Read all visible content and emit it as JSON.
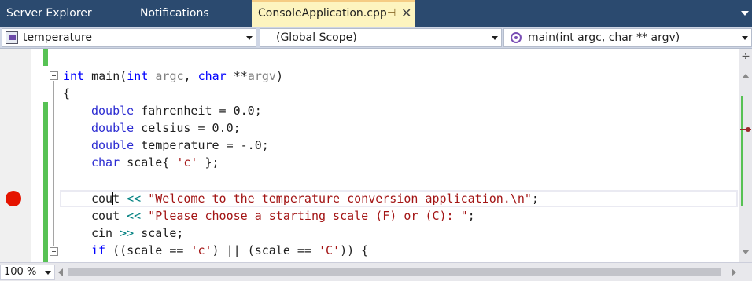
{
  "tabs": {
    "server_explorer": "Server Explorer",
    "notifications": "Notifications",
    "active_file": "ConsoleApplication.cpp",
    "pin_glyph": "⊣",
    "close_glyph": "✕"
  },
  "navbar": {
    "project_combo": "temperature",
    "scope_combo": "(Global Scope)",
    "member_combo": "main(int argc, char ** argv)"
  },
  "code": {
    "line1": {
      "kw_int": "int",
      "name": " main(",
      "kw_int2": "int",
      "p1": " argc",
      "sep": ", ",
      "kw_char": "char",
      "stars": " **",
      "p2": "argv",
      "close": ")"
    },
    "line2": "{",
    "line3": {
      "kw": "double",
      "rest": " fahrenheit = 0.0;"
    },
    "line4": {
      "kw": "double",
      "rest": " celsius = 0.0;"
    },
    "line5": {
      "kw": "double",
      "rest": " temperature = -.0;"
    },
    "line6": {
      "kw": "char",
      "rest": " scale{ ",
      "str": "'c'",
      "end": " };"
    },
    "line8": {
      "a": "cou",
      "b": "t",
      "op": " <<",
      "str": " \"Welcome to the temperature conversion application.\\n\"",
      "end": ";"
    },
    "line9": {
      "a": "cout",
      "op": " <<",
      "str": " \"Please choose a starting scale (F) or (C): \"",
      "end": ";"
    },
    "line10": {
      "a": "cin",
      "op": " >>",
      "rest": " scale;"
    },
    "line11": {
      "kw": "if",
      "a": " ((scale == ",
      "s1": "'c'",
      "b": ") || (scale == ",
      "s2": "'C'",
      "c": ")) {"
    }
  },
  "statusbar": {
    "zoom": "100 %"
  },
  "colors": {
    "tab_bar": "#2b4a6f",
    "active_tab": "#fdf4bf",
    "change_marker": "#57c254",
    "breakpoint": "#e51400",
    "keyword": "#0000ff",
    "string": "#a31515"
  },
  "icons": {
    "project": "class-icon",
    "member": "method-icon",
    "breakpoint": "breakpoint-icon",
    "split": "split-window-icon"
  }
}
